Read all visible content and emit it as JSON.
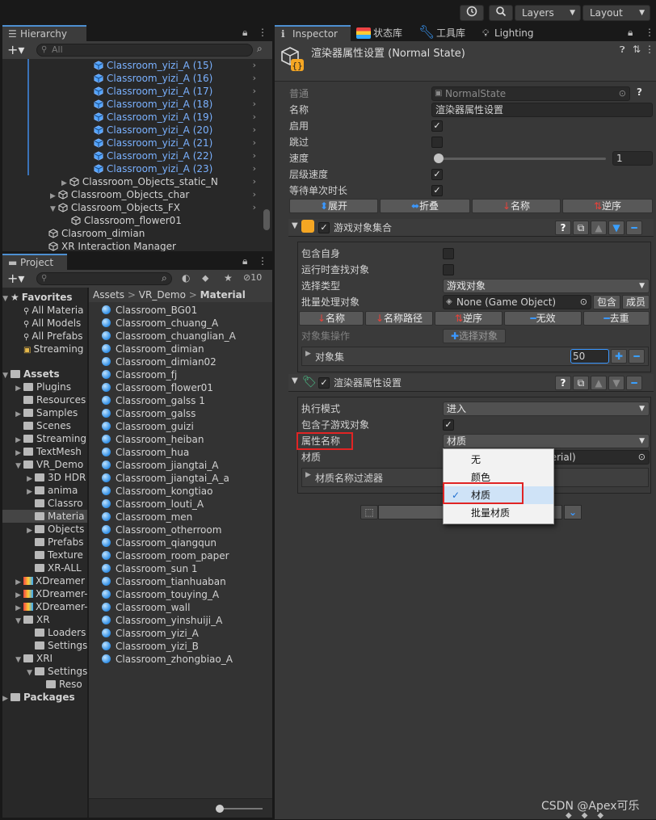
{
  "topbar": {
    "history_icon": "history-icon",
    "search_icon": "search-icon",
    "layers_label": "Layers",
    "layout_label": "Layout"
  },
  "hierarchy": {
    "tab_label": "Hierarchy",
    "search_placeholder": "All",
    "items": [
      {
        "label": "Classroom_yizi_A (15)"
      },
      {
        "label": "Classroom_yizi_A (16)"
      },
      {
        "label": "Classroom_yizi_A (17)"
      },
      {
        "label": "Classroom_yizi_A (18)"
      },
      {
        "label": "Classroom_yizi_A (19)"
      },
      {
        "label": "Classroom_yizi_A (20)"
      },
      {
        "label": "Classroom_yizi_A (21)"
      },
      {
        "label": "Classroom_yizi_A (22)"
      },
      {
        "label": "Classroom_yizi_A (23)"
      },
      {
        "label": "Classroom_Objects_static_N"
      },
      {
        "label": "Classroom_Objects_char"
      },
      {
        "label": "Classroom_Objects_FX"
      },
      {
        "label": "Classroom_flower01"
      },
      {
        "label": "Clasroom_dimian"
      },
      {
        "label": "XR Interaction Manager"
      }
    ]
  },
  "project": {
    "tab_label": "Project",
    "hidden_count": "10",
    "breadcrumb": [
      "Assets",
      "VR_Demo",
      "Material"
    ],
    "tree": [
      {
        "label": "Favorites"
      },
      {
        "label": "All Materia"
      },
      {
        "label": "All Models"
      },
      {
        "label": "All Prefabs"
      },
      {
        "label": "Streaming"
      },
      {
        "label": "Assets"
      },
      {
        "label": "Plugins"
      },
      {
        "label": "Resources"
      },
      {
        "label": "Samples"
      },
      {
        "label": "Scenes"
      },
      {
        "label": "Streaming"
      },
      {
        "label": "TextMesh"
      },
      {
        "label": "VR_Demo"
      },
      {
        "label": "3D HDR"
      },
      {
        "label": "anima"
      },
      {
        "label": "Classro"
      },
      {
        "label": "Materia"
      },
      {
        "label": "Objects"
      },
      {
        "label": "Prefabs"
      },
      {
        "label": "Texture"
      },
      {
        "label": "XR-ALL"
      },
      {
        "label": "XDreamer"
      },
      {
        "label": "XDreamer-"
      },
      {
        "label": "XDreamer-"
      },
      {
        "label": "XR"
      },
      {
        "label": "Loaders"
      },
      {
        "label": "Settings"
      },
      {
        "label": "XRI"
      },
      {
        "label": "Settings"
      },
      {
        "label": "Reso"
      },
      {
        "label": "Packages"
      }
    ],
    "files": [
      "Classroom_BG01",
      "Classroom_chuang_A",
      "Classroom_chuanglian_A",
      "Classroom_dimian",
      "Classroom_dimian02",
      "Classroom_fj",
      "Classroom_flower01",
      "Classroom_galss 1",
      "Classroom_galss",
      "Classroom_guizi",
      "Classroom_heiban",
      "Classroom_hua",
      "Classroom_jiangtai_A",
      "Classroom_jiangtai_A_a",
      "Classroom_kongtiao",
      "Classroom_louti_A",
      "Classroom_men",
      "Classroom_otherroom",
      "Classroom_qiangqun",
      "Classroom_room_paper",
      "Classroom_sun 1",
      "Classroom_tianhuaban",
      "Classroom_touying_A",
      "Classroom_wall",
      "Classroom_yinshuiji_A",
      "Classroom_yizi_A",
      "Classroom_yizi_B",
      "Classroom_zhongbiao_A"
    ]
  },
  "inspector": {
    "tabs": [
      "Inspector",
      "状态库",
      "工具库",
      "Lighting"
    ],
    "header_title": "渲染器属性设置 (Normal State)",
    "fields": {
      "general_label": "普通",
      "general_value": "NormalState",
      "name_label": "名称",
      "name_value": "渲染器属性设置",
      "enable_label": "启用",
      "skip_label": "跳过",
      "speed_label": "速度",
      "speed_value": "1",
      "level_speed_label": "层级速度",
      "wait_label": "等待单次时长"
    },
    "toolbar": {
      "expand": "展开",
      "collapse": "折叠",
      "name": "名称",
      "reverse": "逆序"
    },
    "group1": {
      "title": "游戏对象集合",
      "include_self_label": "包含自身",
      "runtime_find_label": "运行时查找对象",
      "select_type_label": "选择类型",
      "select_type_value": "游戏对象",
      "batch_label": "批量处理对象",
      "batch_value": "None (Game Object)",
      "include_btn": "包含",
      "member_btn": "成员",
      "sort_name": "名称",
      "sort_path": "名称路径",
      "sort_reverse": "逆序",
      "sort_none": "无效",
      "sort_dedupe": "去重",
      "ops_label": "对象集操作",
      "select_objects_btn": "选择对象",
      "set_label": "对象集",
      "set_count": "50"
    },
    "group2": {
      "title": "渲染器属性设置",
      "exec_mode_label": "执行模式",
      "exec_mode_value": "进入",
      "include_children_label": "包含子游戏对象",
      "prop_name_label": "属性名称",
      "prop_name_value": "材质",
      "material_label": "材质",
      "material_value_partial": "terial)",
      "filter_label": "材质名称过滤器"
    },
    "dropdown_options": [
      {
        "label": "无",
        "checked": false
      },
      {
        "label": "颜色",
        "checked": false
      },
      {
        "label": "材质",
        "checked": true
      },
      {
        "label": "批量材质",
        "checked": false
      }
    ],
    "colors": {
      "accent": "#3b98ff",
      "highlight_red": "#e02424"
    }
  },
  "watermark": "CSDN @Apex可乐"
}
